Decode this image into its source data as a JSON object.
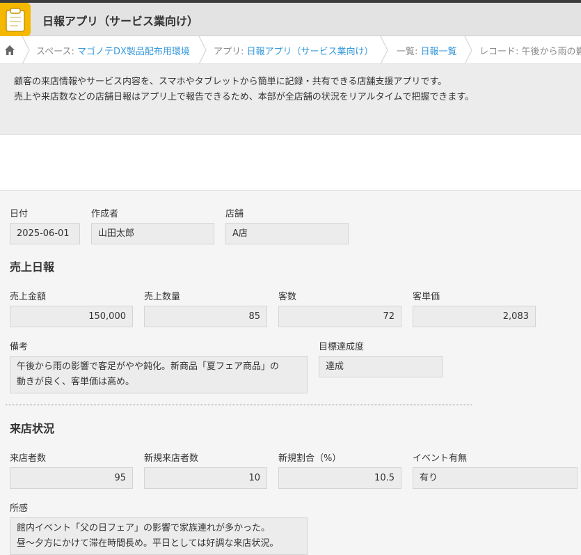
{
  "header": {
    "title": "日報アプリ（サービス業向け）",
    "icon": "clipboard-icon",
    "accent": "#f5b800"
  },
  "breadcrumb": {
    "home_icon": "home-icon",
    "space_prefix": "スペース: ",
    "space_link": "マゴノテDX製品配布用環境",
    "app_prefix": "アプリ: ",
    "app_link": "日報アプリ（サービス業向け）",
    "list_prefix": "一覧: ",
    "list_link": "日報一覧",
    "record_prefix": "レコード: ",
    "record_text": "午後から雨の影"
  },
  "description": {
    "line1": "顧客の来店情報やサービス内容を、スマホやタブレットから簡単に記録・共有できる店舗支援アプリです。",
    "line2": "売上や来店数などの店舗日報はアプリ上で報告できるため、本部が全店舗の状況をリアルタイムで把握できます。"
  },
  "record": {
    "date": {
      "label": "日付",
      "value": "2025-06-01"
    },
    "author": {
      "label": "作成者",
      "value": "山田太郎"
    },
    "store": {
      "label": "店舗",
      "value": "A店"
    },
    "sales_section": "売上日報",
    "sales_amount": {
      "label": "売上金額",
      "value": "150,000"
    },
    "sales_qty": {
      "label": "売上数量",
      "value": "85"
    },
    "customers": {
      "label": "客数",
      "value": "72"
    },
    "unit_price": {
      "label": "客単価",
      "value": "2,083"
    },
    "notes": {
      "label": "備考",
      "line1": "午後から雨の影響で客足がやや鈍化。新商品「夏フェア商品」の",
      "line2": "動きが良く、客単価は高め。"
    },
    "goal": {
      "label": "目標達成度",
      "value": "達成"
    },
    "visit_section": "来店状況",
    "visitors": {
      "label": "来店者数",
      "value": "95"
    },
    "new_visitors": {
      "label": "新規来店者数",
      "value": "10"
    },
    "new_ratio": {
      "label": "新規割合（%）",
      "value": "10.5"
    },
    "event": {
      "label": "イベント有無",
      "value": "有り"
    },
    "impressions": {
      "label": "所感",
      "line1": "館内イベント「父の日フェア」の影響で家族連れが多かった。",
      "line2": "昼〜夕方にかけて滞在時間長め。平日としては好調な来店状況。"
    }
  }
}
